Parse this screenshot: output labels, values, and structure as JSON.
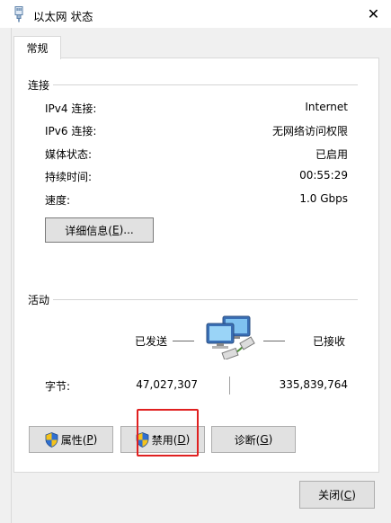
{
  "window": {
    "title": "以太网 状态",
    "close_glyph": "✕"
  },
  "tabs": [
    {
      "label": "常规"
    }
  ],
  "connection": {
    "section_title": "连接",
    "rows": [
      {
        "label": "IPv4 连接:",
        "value": "Internet"
      },
      {
        "label": "IPv6 连接:",
        "value": "无网络访问权限"
      },
      {
        "label": "媒体状态:",
        "value": "已启用"
      },
      {
        "label": "持续时间:",
        "value": "00:55:29"
      },
      {
        "label": "速度:",
        "value": "1.0 Gbps"
      }
    ],
    "details_button": {
      "text": "详细信息(",
      "key": "E",
      "suffix": ")..."
    }
  },
  "activity": {
    "section_title": "活动",
    "sent_label": "已发送",
    "received_label": "已接收",
    "bytes_label": "字节:",
    "bytes_sent": "47,027,307",
    "bytes_received": "335,839,764"
  },
  "buttons": {
    "properties": {
      "text": "属性(",
      "key": "P",
      "suffix": ")"
    },
    "disable": {
      "text": "禁用(",
      "key": "D",
      "suffix": ")"
    },
    "diagnose": {
      "text": "诊断(",
      "key": "G",
      "suffix": ")"
    },
    "close": {
      "text": "关闭(",
      "key": "C",
      "suffix": ")"
    }
  },
  "colors": {
    "highlight": "#e02020",
    "shield_blue": "#2f6fd0",
    "shield_yellow": "#f4c21b"
  },
  "icons": {
    "title": "ethernet-adapter-icon",
    "activity": "network-computers-icon",
    "shield": "uac-shield-icon"
  }
}
